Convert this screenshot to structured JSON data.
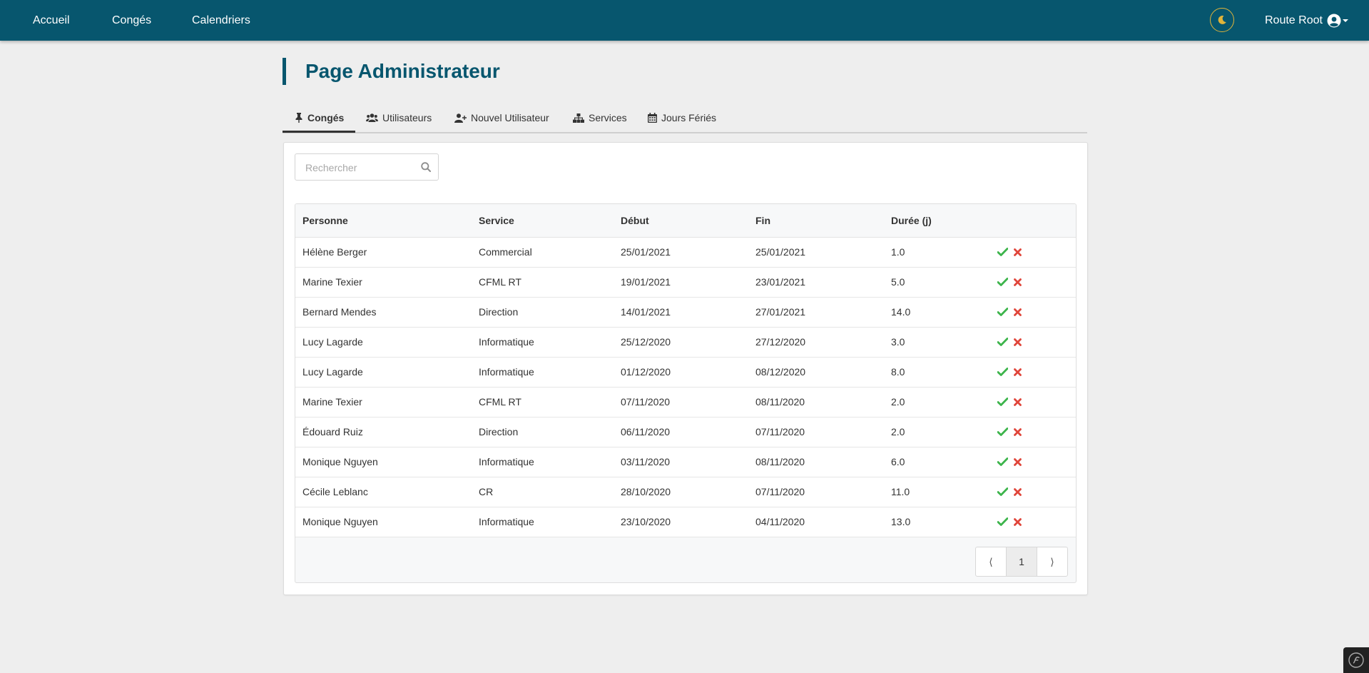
{
  "nav": {
    "links": [
      {
        "label": "Accueil"
      },
      {
        "label": "Congés"
      },
      {
        "label": "Calendriers"
      }
    ],
    "theme_icon": "moon-icon",
    "user_name": "Route Root",
    "user_icon": "user-circle-icon"
  },
  "page": {
    "title": "Page Administrateur"
  },
  "tabs": [
    {
      "label": "Congés",
      "icon": "thumbtack-icon",
      "active": true
    },
    {
      "label": "Utilisateurs",
      "icon": "users-icon",
      "active": false
    },
    {
      "label": "Nouvel Utilisateur",
      "icon": "user-plus-icon",
      "active": false
    },
    {
      "label": "Services",
      "icon": "sitemap-icon",
      "active": false
    },
    {
      "label": "Jours Fériés",
      "icon": "calendar-icon",
      "active": false
    }
  ],
  "search": {
    "placeholder": "Rechercher",
    "value": ""
  },
  "table": {
    "columns": [
      "Personne",
      "Service",
      "Début",
      "Fin",
      "Durée (j)",
      ""
    ],
    "rows": [
      {
        "personne": "Hélène Berger",
        "service": "Commercial",
        "debut": "25/01/2021",
        "fin": "25/01/2021",
        "duree": "1.0"
      },
      {
        "personne": "Marine Texier",
        "service": "CFML RT",
        "debut": "19/01/2021",
        "fin": "23/01/2021",
        "duree": "5.0"
      },
      {
        "personne": "Bernard Mendes",
        "service": "Direction",
        "debut": "14/01/2021",
        "fin": "27/01/2021",
        "duree": "14.0"
      },
      {
        "personne": "Lucy Lagarde",
        "service": "Informatique",
        "debut": "25/12/2020",
        "fin": "27/12/2020",
        "duree": "3.0"
      },
      {
        "personne": "Lucy Lagarde",
        "service": "Informatique",
        "debut": "01/12/2020",
        "fin": "08/12/2020",
        "duree": "8.0"
      },
      {
        "personne": "Marine Texier",
        "service": "CFML RT",
        "debut": "07/11/2020",
        "fin": "08/11/2020",
        "duree": "2.0"
      },
      {
        "personne": "Édouard Ruiz",
        "service": "Direction",
        "debut": "06/11/2020",
        "fin": "07/11/2020",
        "duree": "2.0"
      },
      {
        "personne": "Monique Nguyen",
        "service": "Informatique",
        "debut": "03/11/2020",
        "fin": "08/11/2020",
        "duree": "6.0"
      },
      {
        "personne": "Cécile Leblanc",
        "service": "CR",
        "debut": "28/10/2020",
        "fin": "07/11/2020",
        "duree": "11.0"
      },
      {
        "personne": "Monique Nguyen",
        "service": "Informatique",
        "debut": "23/10/2020",
        "fin": "04/11/2020",
        "duree": "13.0"
      }
    ],
    "approve_icon": "check-icon",
    "reject_icon": "cross-icon"
  },
  "pagination": {
    "prev": "⟨",
    "current": "1",
    "next": "⟩"
  },
  "colors": {
    "navbar": "#07566e",
    "accent": "#07566e",
    "approve": "#3cb44b",
    "reject": "#e0453a",
    "theme_ring": "#e0b43a"
  }
}
